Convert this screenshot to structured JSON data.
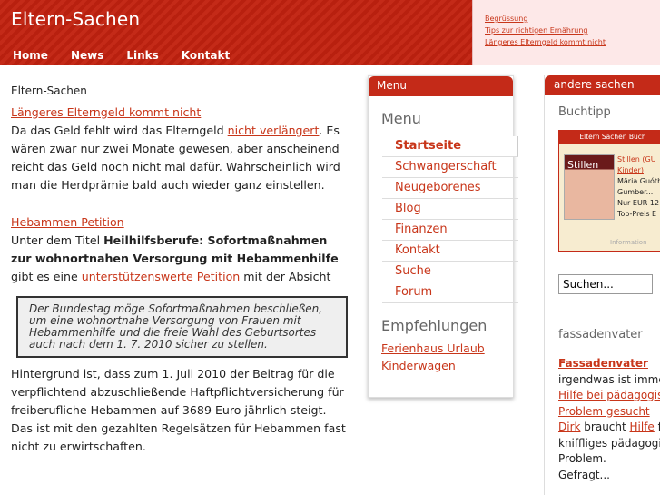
{
  "header": {
    "title": "Eltern-Sachen",
    "nav": [
      "Home",
      "News",
      "Links",
      "Kontakt"
    ],
    "right_links": [
      "Begrüssung",
      "Tips zur richtigen Ernährung",
      "Längeres Elterngeld kommt nicht"
    ]
  },
  "main": {
    "breadcrumb": "Eltern-Sachen",
    "article1": {
      "title": "Längeres Elterngeld kommt nicht",
      "t1": "Da das Geld fehlt wird das Elterngeld ",
      "link": "nicht verlängert",
      "t2": ". Es wären zwar nur zwei Monate gewesen, aber anscheinend reicht das Geld noch nicht mal dafür. Wahrscheinlich wird man die Herdprämie bald auch wieder ganz einstellen."
    },
    "article2": {
      "title": "Hebammen Petition",
      "t1": "Unter dem Titel ",
      "bold": "Heilhilfsberufe: Sofortmaßnahmen zur wohnortnahen Versorgung mit Hebammenhilfe",
      "t2": " gibt es eine ",
      "link": "unterstützenswerte Petition",
      "t3": " mit der Absicht",
      "quote": "Der Bundestag möge Sofortmaßnahmen beschließen, um eine wohnortnahe Versorgung von Frauen mit Hebammenhilfe und die freie Wahl des Geburtsortes auch nach dem 1. 7. 2010 sicher zu stellen.",
      "t4": "Hintergrund ist, dass zum 1. Juli 2010 der Beitrag für die verpflichtend abzuschließende Haftpflichtversicherung für freiberufliche Hebammen auf 3689 Euro jährlich steigt. Das ist mit den gezahlten Regelsätzen für Hebammen fast nicht zu erwirtschaften."
    }
  },
  "menu": {
    "header": "Menu",
    "section": "Menu",
    "items": [
      "Startseite",
      "Schwangerschaft",
      "Neugeborenes",
      "Blog",
      "Finanzen",
      "Kontakt",
      "Suche",
      "Forum"
    ],
    "recommend_title": "Empfehlungen",
    "recommend": [
      "Ferienhaus Urlaub",
      "Kinderwagen"
    ]
  },
  "sidebar": {
    "header": "andere sachen",
    "buchtipp": "Buchtipp",
    "book_header": "Eltern Sachen Buch",
    "book_cover": "Stillen",
    "book_title": "Stillen (GU",
    "book_link2": "Kinder)",
    "book_author": "Märia Guóth",
    "book_author2": "Gumber...",
    "book_price": "Nur EUR 12",
    "book_price2": "Top-Preis E",
    "book_info": "Information",
    "search_value": "Suchen...",
    "fassaden_title": "fassadenvater",
    "n1_bold": "Fassadenvater",
    "n2": "irgendwas ist immer",
    "n3": "Hilfe bei pädagogis",
    "n4": "Problem gesucht",
    "n5a": "Dirk",
    "n5b": " braucht ",
    "n5c": "Hilfe",
    "n5d": " fü",
    "n6": "kniffliges pädagogi",
    "n7": "Problem.",
    "n8": "Gefragt..."
  }
}
